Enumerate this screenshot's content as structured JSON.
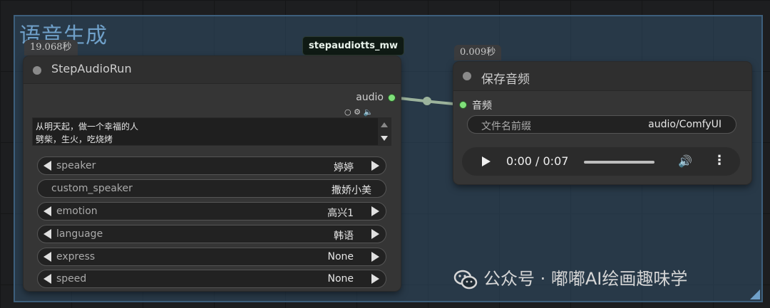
{
  "group": {
    "title": "语音生成"
  },
  "node_a": {
    "time": "19.068秒",
    "tag": "stepaudiotts_mw",
    "title": "StepAudioRun",
    "output_label": "audio",
    "text_lines": [
      "从明天起，做一个幸福的人",
      "劈柴，生火，吃烧烤"
    ],
    "widgets": [
      {
        "label": "speaker",
        "value": "婷婷"
      },
      {
        "label": "custom_speaker",
        "value": "撒娇小美"
      },
      {
        "label": "emotion",
        "value": "高兴1"
      },
      {
        "label": "language",
        "value": "韩语"
      },
      {
        "label": "express",
        "value": "None"
      },
      {
        "label": "speed",
        "value": "None"
      }
    ]
  },
  "node_b": {
    "time": "0.009秒",
    "title": "保存音频",
    "input_label": "音频",
    "filename_label": "文件名前缀",
    "filename_value": "audio/ComfyUI",
    "player_time": "0:00 / 0:07"
  },
  "watermark": "公众号 · 嘟嘟AI绘画趣味学",
  "colors": {
    "slot_green": "#7fe07a",
    "group_blue": "#6fa0c9",
    "node_bg": "#353535"
  },
  "icons": [
    "settings-icon",
    "speaker-icon",
    "play-icon",
    "volume-icon",
    "more-vertical-icon",
    "wechat-icon"
  ]
}
